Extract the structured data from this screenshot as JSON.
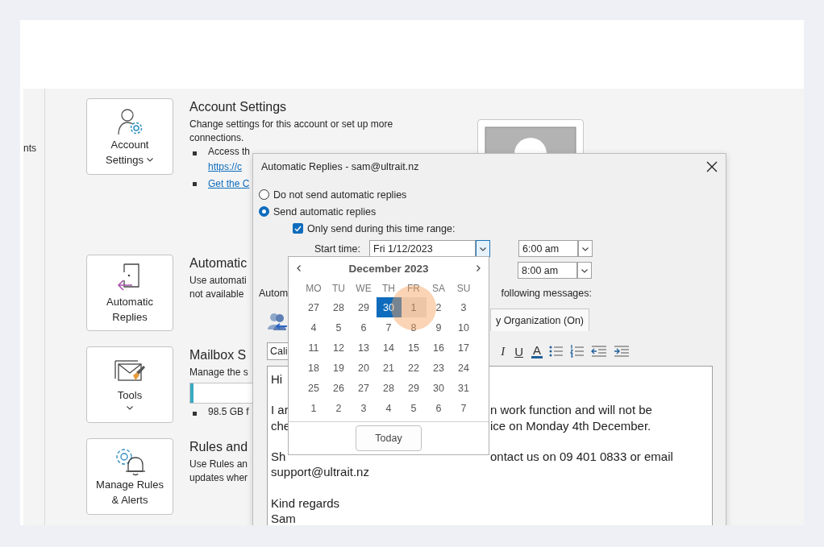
{
  "sidebar_fragment": "nts",
  "sections": [
    {
      "kind": "account",
      "button_lines": [
        "Account",
        "Settings"
      ],
      "caret": true,
      "title": "Account Settings",
      "text_lines": [
        "Change settings for this account or set up more",
        "connections."
      ],
      "bullets": [
        {
          "lines": [
            {
              "text": "Access th",
              "link": false
            },
            {
              "text": "https://c",
              "link": true
            }
          ]
        },
        {
          "lines": [
            {
              "text": "Get the C",
              "link": true
            }
          ]
        }
      ]
    },
    {
      "kind": "automatic",
      "button_lines": [
        "Automatic",
        "Replies"
      ],
      "title": "Automatic",
      "text_lines": [
        "Use automati",
        "not available"
      ]
    },
    {
      "kind": "tools",
      "button_lines": [
        "Tools"
      ],
      "caret": true,
      "title": "Mailbox S",
      "text_lines": [
        "Manage the s"
      ],
      "storage": {
        "level": 0.04
      },
      "bullets": [
        {
          "lines": [
            {
              "text": "98.5 GB f",
              "link": false
            }
          ]
        }
      ]
    },
    {
      "kind": "rules",
      "button_lines": [
        "Manage Rules",
        "& Alerts"
      ],
      "title": "Rules and",
      "text_lines": [
        "Use Rules an",
        "updates wher"
      ]
    }
  ],
  "dialog": {
    "title": "Automatic Replies - sam@ultrait.nz",
    "options": [
      {
        "label": "Do not send automatic replies",
        "selected": false
      },
      {
        "label": "Send automatic replies",
        "selected": true
      }
    ],
    "time_range": {
      "label": "Only send during this time range:",
      "checked": true
    },
    "start": {
      "label": "Start time:",
      "date": "Fri 1/12/2023",
      "time": "6:00 am"
    },
    "end": {
      "time": "8:00 am"
    },
    "messages_label_start": "Autom",
    "messages_label_end": "following messages:",
    "tab": {
      "label": "y Organization (On)"
    },
    "font": "Cali",
    "format_buttons": [
      {
        "kind": "italic",
        "label": "I"
      },
      {
        "kind": "underline",
        "label": "U"
      },
      {
        "kind": "color",
        "label": "A"
      },
      {
        "kind": "bullets"
      },
      {
        "kind": "numbering"
      },
      {
        "kind": "outdent"
      },
      {
        "kind": "indent"
      }
    ],
    "message_lines": [
      {
        "kind": "text",
        "left": "Hi"
      },
      {
        "kind": "blank"
      },
      {
        "kind": "text",
        "left": "I ar",
        "right": "n work function and will not be"
      },
      {
        "kind": "text",
        "left": "che",
        "right": "ice on Monday 4th December."
      },
      {
        "kind": "blank"
      },
      {
        "kind": "text",
        "left": "Sh",
        "right": "ontact us on 09 401 0833 or email"
      },
      {
        "kind": "text",
        "left": "support@ultrait.nz"
      },
      {
        "kind": "blank"
      },
      {
        "kind": "text",
        "left": "Kind regards"
      },
      {
        "kind": "text",
        "left": "Sam"
      }
    ]
  },
  "calendar": {
    "month": "December 2023",
    "weekdays": [
      "MO",
      "TU",
      "WE",
      "TH",
      "FR",
      "SA",
      "SU"
    ],
    "weeks": [
      [
        {
          "day": "27",
          "selected": false,
          "hovered": false
        },
        {
          "day": "28",
          "selected": false,
          "hovered": false
        },
        {
          "day": "29",
          "selected": false,
          "hovered": false
        },
        {
          "day": "30",
          "selected": true,
          "hovered": false
        },
        {
          "day": "1",
          "selected": false,
          "hovered": true
        },
        {
          "day": "2",
          "selected": false,
          "hovered": false
        },
        {
          "day": "3",
          "selected": false,
          "hovered": false
        }
      ],
      [
        {
          "day": "4",
          "selected": false,
          "hovered": false
        },
        {
          "day": "5",
          "selected": false,
          "hovered": false
        },
        {
          "day": "6",
          "selected": false,
          "hovered": false
        },
        {
          "day": "7",
          "selected": false,
          "hovered": false
        },
        {
          "day": "8",
          "selected": false,
          "hovered": false
        },
        {
          "day": "9",
          "selected": false,
          "hovered": false
        },
        {
          "day": "10",
          "selected": false,
          "hovered": false
        }
      ],
      [
        {
          "day": "11",
          "selected": false,
          "hovered": false
        },
        {
          "day": "12",
          "selected": false,
          "hovered": false
        },
        {
          "day": "13",
          "selected": false,
          "hovered": false
        },
        {
          "day": "14",
          "selected": false,
          "hovered": false
        },
        {
          "day": "15",
          "selected": false,
          "hovered": false
        },
        {
          "day": "16",
          "selected": false,
          "hovered": false
        },
        {
          "day": "17",
          "selected": false,
          "hovered": false
        }
      ],
      [
        {
          "day": "18",
          "selected": false,
          "hovered": false
        },
        {
          "day": "19",
          "selected": false,
          "hovered": false
        },
        {
          "day": "20",
          "selected": false,
          "hovered": false
        },
        {
          "day": "21",
          "selected": false,
          "hovered": false
        },
        {
          "day": "22",
          "selected": false,
          "hovered": false
        },
        {
          "day": "23",
          "selected": false,
          "hovered": false
        },
        {
          "day": "24",
          "selected": false,
          "hovered": false
        }
      ],
      [
        {
          "day": "25",
          "selected": false,
          "hovered": false
        },
        {
          "day": "26",
          "selected": false,
          "hovered": false
        },
        {
          "day": "27",
          "selected": false,
          "hovered": false
        },
        {
          "day": "28",
          "selected": false,
          "hovered": false
        },
        {
          "day": "29",
          "selected": false,
          "hovered": false
        },
        {
          "day": "30",
          "selected": false,
          "hovered": false
        },
        {
          "day": "31",
          "selected": false,
          "hovered": false
        }
      ],
      [
        {
          "day": "1",
          "selected": false,
          "hovered": false
        },
        {
          "day": "2",
          "selected": false,
          "hovered": false
        },
        {
          "day": "3",
          "selected": false,
          "hovered": false
        },
        {
          "day": "4",
          "selected": false,
          "hovered": false
        },
        {
          "day": "5",
          "selected": false,
          "hovered": false
        },
        {
          "day": "6",
          "selected": false,
          "hovered": false
        },
        {
          "day": "7",
          "selected": false,
          "hovered": false
        }
      ]
    ],
    "today_button": "Today"
  }
}
